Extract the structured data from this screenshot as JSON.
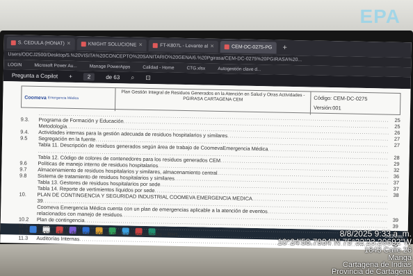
{
  "watermark": "EPA",
  "browser": {
    "tabs": [
      {
        "label": "S. CEDULA (HONAT)",
        "active": false
      },
      {
        "label": "KNIGHT SOLUCIONE",
        "active": false
      },
      {
        "label": "FT-K807L - Levante al",
        "active": false
      },
      {
        "label": "CEM-DC-0275-PG",
        "active": true
      }
    ],
    "new_tab": "+",
    "url": "Users/ODCJ2500/Desktop/5.%20VISITA%20CONCEPTO%20SANITARIO%20GENA/6.%20Pgirasa/CEM-DC-0275%20PGIRASA%20...",
    "bookmarks": [
      "LOGIN",
      "Microsoft Power Au...",
      "Manage PowerApps",
      "Calidad - Home",
      "CTG.xlsx",
      "Autogestión clave d..."
    ],
    "pdf": {
      "ask_copilot": "Pregunta a Copilot",
      "add": "+",
      "page_current": "2",
      "page_total": "de 63",
      "search_glyph": "⌕",
      "reader_glyph": "⊡"
    }
  },
  "doc_header": {
    "logo_name": "Coomeva",
    "logo_sub": "Emergencia Médica",
    "title": "Plan Gestión Integral de Residuos Generados en la Atención en Salud y Otras Actividades - PGIRASA CARTAGENA CEM",
    "code": "Código: CEM-DC-0275",
    "version": "Versión:001"
  },
  "toc": [
    {
      "num": "",
      "title": "",
      "page": "25"
    },
    {
      "num": "9.3.",
      "title": "Programa de Formación y Educación",
      "page": "25"
    },
    {
      "num": "",
      "title": "Metodología",
      "page": "26"
    },
    {
      "num": "9.4.",
      "title": "Actividades internas para la gestión adecuada de residuos hospitalarios  y similares",
      "page": "27"
    },
    {
      "num": "9.5",
      "title": "Segregación en la fuente",
      "page": "27"
    },
    {
      "num": "",
      "title": "Tabla 11. Descripción de residuos generados según área de trabajo de CoomevaEmergencia Médica",
      "page": ""
    },
    {
      "num": "",
      "title": "",
      "page": "28"
    },
    {
      "num": "",
      "title": "Tabla 12. Código de colores de contenedores para los residuos generados CEM",
      "page": "29"
    },
    {
      "num": "9.6",
      "title": "Políticas de manejo interno de residuos hospitalarios",
      "page": "32"
    },
    {
      "num": "9.7",
      "title": "Almacenamiento de residuos hospitalarios y similares, almacenamiento central",
      "page": "36"
    },
    {
      "num": "9.8",
      "title": "Sistema de tratamiento de residuos hospitalarios y similares",
      "page": "37"
    },
    {
      "num": "",
      "title": "Tabla 13. Gestores de residuos hospitalarios por sede",
      "page": "37"
    },
    {
      "num": "",
      "title": "Tabla 14. Reporte de vertimientos líquidos por sede",
      "page": "38"
    },
    {
      "num": "10.",
      "title": "PLAN DE CONTINGENCIA Y SEGURIDAD INDUSTRIAL COOMEVA EMERGENCIA MEDICA",
      "page": ""
    },
    {
      "num": "",
      "title": "39",
      "page": ""
    },
    {
      "num": "",
      "title": "Coomeva Emergencia Médica cuenta con un plan de emergencias aplicable a la atención de eventos",
      "page": ""
    },
    {
      "num": "",
      "title": "relacionados con manejo de residuos",
      "page": "39"
    },
    {
      "num": "10.2",
      "title": "Plan de contingencia",
      "page": "39"
    },
    {
      "num": "11.1",
      "title": "Costo",
      "page": "44"
    },
    {
      "num": "11.2",
      "title": "Registro diario de generación de residuos hospitalarios – RH1",
      "page": "44"
    },
    {
      "num": "11.3",
      "title": "Auditorías Internas",
      "page": "45"
    }
  ],
  "taskbar": {
    "icon_colors": [
      "#3d7fd6",
      "#e8e8e8",
      "#d64545",
      "#7a5bd6",
      "#2b6fd6",
      "#e0a030",
      "#2f9e5a",
      "#3aa0e0",
      "#c94040",
      "#1e8d6e"
    ],
    "clock": "9:33 a.m."
  },
  "stamp": {
    "datetime": "8/8/2025 9:33 a. m.",
    "coords": "10°24'58.7934\"N 75°32'23.20692\"W",
    "address": "1843 Calle 26",
    "place1": "Manga",
    "place2": "Cartagena de Indias",
    "place3": "Provincia de Cartagena"
  }
}
